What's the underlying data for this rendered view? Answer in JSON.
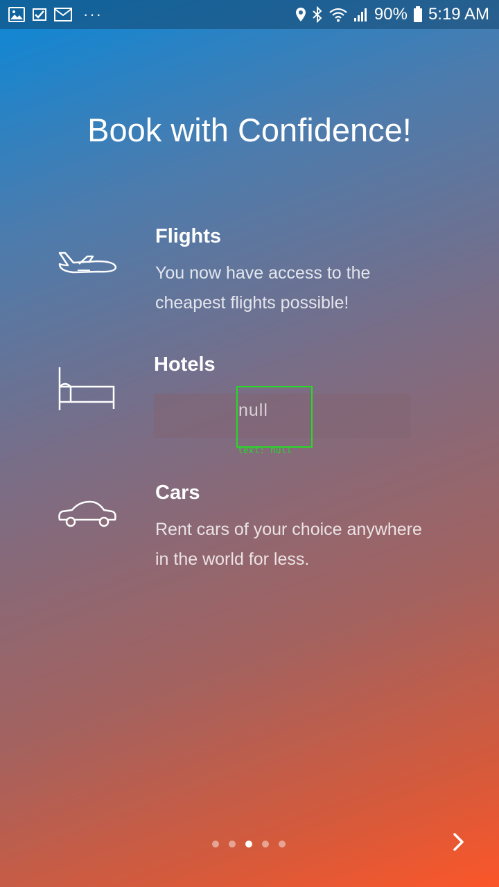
{
  "status_bar": {
    "left_icons": [
      "gallery-icon",
      "task-check-icon",
      "gmail-icon"
    ],
    "more": "···",
    "battery": "90%",
    "time": "5:19 AM",
    "right_icons": [
      "location-icon",
      "bluetooth-icon",
      "wifi-icon",
      "signal-icon",
      "battery-icon"
    ]
  },
  "onboarding": {
    "title": "Book with Confidence!",
    "features": [
      {
        "icon": "airplane-icon",
        "title": "Flights",
        "description": "You now have access to the cheapest flights possible!"
      },
      {
        "icon": "bed-icon",
        "title": "Hotels",
        "description": "null"
      },
      {
        "icon": "car-icon",
        "title": "Cars",
        "description": "Rent cars of your choice anywhere in the world for less."
      }
    ],
    "debug_label": "text: null"
  },
  "pager": {
    "page_count": 5,
    "current_page": 3
  },
  "next_button": {
    "icon": "chevron-right-icon"
  },
  "colors": {
    "gradient_start": "#0a88d8",
    "gradient_end": "#fb5629",
    "debug_green": "#27d827"
  }
}
